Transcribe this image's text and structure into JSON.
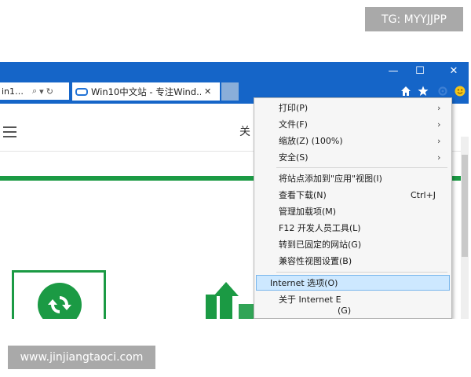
{
  "watermarks": {
    "top": "TG: MYYJJPP",
    "bottom": "www.jinjiangtaoci.com"
  },
  "window": {
    "minimize_glyph": "—",
    "maximize_glyph": "☐",
    "close_glyph": "✕"
  },
  "address_bar": {
    "text": "in1…",
    "search_glyph": "⌕",
    "dropdown_glyph": "▾",
    "refresh_glyph": "↻"
  },
  "tabs": [
    {
      "title": "Win10中文站 - 专注Wind...",
      "close_glyph": "✕",
      "active": true
    }
  ],
  "toolbar_icons": [
    "home-icon",
    "favorites-star-icon",
    "settings-gear-icon",
    "smiley-feedback-icon"
  ],
  "page": {
    "header_text": "关",
    "accent_color": "#1b9a44"
  },
  "menu": {
    "items": [
      {
        "label": "打印(P)",
        "submenu": true
      },
      {
        "label": "文件(F)",
        "submenu": true
      },
      {
        "label": "缩放(Z) (100%)",
        "submenu": true
      },
      {
        "label": "安全(S)",
        "submenu": true
      },
      {
        "label": "将站点添加到\"应用\"视图(I)",
        "submenu": false
      },
      {
        "label": "查看下载(N)",
        "shortcut": "Ctrl+J"
      },
      {
        "label": "管理加载项(M)"
      },
      {
        "label": "F12 开发人员工具(L)"
      },
      {
        "label": "转到已固定的网站(G)"
      },
      {
        "label": "兼容性视图设置(B)"
      },
      {
        "label": "Internet 选项(O)",
        "highlighted": true
      },
      {
        "label": "关于 Internet E"
      },
      {
        "label": "(G)"
      }
    ],
    "submenu_glyph": "›"
  },
  "colors": {
    "titlebar": "#1565c8",
    "menu_highlight": "#cde8ff",
    "watermark_bg": "#a9a9a9"
  }
}
